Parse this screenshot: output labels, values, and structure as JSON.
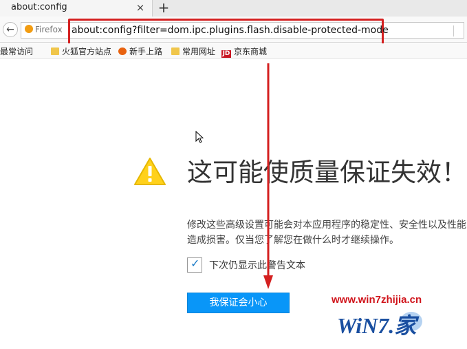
{
  "tab": {
    "title": "about:config",
    "close_glyph": "×"
  },
  "new_tab_glyph": "+",
  "nav": {
    "back_glyph": "←",
    "identity_label": "Firefox",
    "url": "about:config?filter=dom.ipc.plugins.flash.disable-protected-mode"
  },
  "bookmarks": [
    {
      "label": "最常访问",
      "icon": "gear-icon"
    },
    {
      "label": "火狐官方站点",
      "icon": "folder-icon"
    },
    {
      "label": "新手上路",
      "icon": "firefox-icon"
    },
    {
      "label": "常用网址",
      "icon": "folder-icon"
    },
    {
      "label": "京东商城",
      "icon": "jd-icon"
    }
  ],
  "jd_icon_text": "JD",
  "warning": {
    "title": "这可能使质量保证失效！",
    "description": "修改这些高级设置可能会对本应用程序的稳定性、安全性以及性能造成损害。仅当您了解您在做什么时才继续操作。",
    "checkbox_label": "下次仍显示此警告文本",
    "checkbox_checked": true,
    "checkbox_glyph": "✓",
    "button_label": "我保证会小心"
  },
  "watermark": {
    "url": "www.win7zhijia.cn",
    "logo_text": "WiN7.家"
  },
  "colors": {
    "annotation_red": "#d42020",
    "button_blue": "#0996f8",
    "warning_yellow": "#ffd11c"
  }
}
